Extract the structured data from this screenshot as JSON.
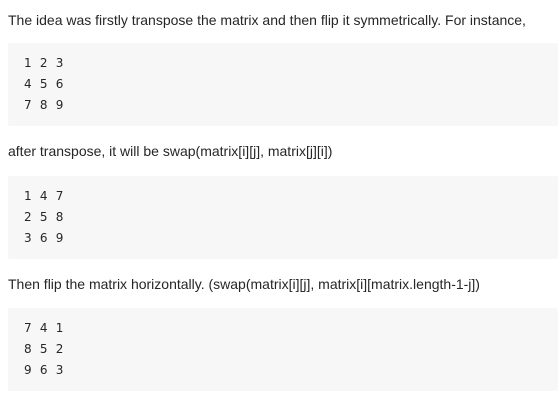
{
  "paragraphs": [
    "The idea was firstly transpose the matrix and then flip it symmetrically. For instance,",
    "after transpose, it will be swap(matrix[i][j], matrix[j][i])",
    "Then flip the matrix horizontally. (swap(matrix[i][j], matrix[i][matrix.length-1-j])"
  ],
  "code_blocks": [
    {
      "lines": [
        "1  2  3",
        "4  5  6",
        "7  8  9"
      ]
    },
    {
      "lines": [
        "1  4  7",
        "2  5  8",
        "3  6  9"
      ]
    },
    {
      "lines": [
        "7  4  1",
        "8  5  2",
        "9  6  3"
      ]
    }
  ]
}
